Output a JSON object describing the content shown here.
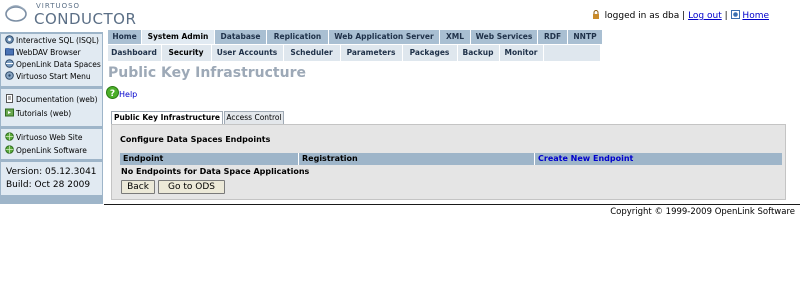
{
  "header": {
    "logo_small": "VIRTUOSO",
    "logo_big": "CONDUCTOR",
    "logged_in_text": "logged in as dba",
    "separator": "|",
    "logout_label": "Log out",
    "home_label": "Home"
  },
  "sidebar": {
    "group1": [
      {
        "label": "Interactive SQL (ISQL)",
        "icon": "isql-icon"
      },
      {
        "label": "WebDAV Browser",
        "icon": "folder-icon"
      },
      {
        "label": "OpenLink Data Spaces",
        "icon": "ods-icon"
      },
      {
        "label": "Virtuoso Start Menu",
        "icon": "virtuoso-icon"
      }
    ],
    "group2": [
      {
        "label": "Documentation (web)",
        "icon": "document-icon"
      },
      {
        "label": "Tutorials (web)",
        "icon": "tutorial-icon"
      }
    ],
    "group3": [
      {
        "label": "Virtuoso Web Site",
        "icon": "globe-icon"
      },
      {
        "label": "OpenLink Software",
        "icon": "globe-icon"
      }
    ],
    "version": "Version: 05.12.3041",
    "build": "Build: Oct 28 2009"
  },
  "top_tabs": [
    {
      "label": "Home"
    },
    {
      "label": "System Admin",
      "active": true
    },
    {
      "label": "Database"
    },
    {
      "label": "Replication"
    },
    {
      "label": "Web Application Server"
    },
    {
      "label": "XML"
    },
    {
      "label": "Web Services"
    },
    {
      "label": "RDF"
    },
    {
      "label": "NNTP"
    }
  ],
  "sub_tabs": [
    {
      "label": "Dashboard"
    },
    {
      "label": "Security",
      "active": true
    },
    {
      "label": "User Accounts"
    },
    {
      "label": "Scheduler"
    },
    {
      "label": "Parameters"
    },
    {
      "label": "Packages"
    },
    {
      "label": "Backup"
    },
    {
      "label": "Monitor"
    }
  ],
  "page_title": "Public Key Infrastructure",
  "help_label": "Help",
  "content_tabs": {
    "pki": "Public Key Infrastructure",
    "access_control": "Access Control"
  },
  "section_heading": "Configure Data Spaces Endpoints",
  "table": {
    "columns": [
      "Endpoint",
      "Registration"
    ],
    "create_link": "Create New Endpoint",
    "empty_message": "No Endpoints for Data Space Applications"
  },
  "buttons": {
    "back": "Back",
    "go_to_ods": "Go to ODS"
  },
  "footer": {
    "copyright": "Copyright © 1999-2009 OpenLink Software"
  },
  "colors": {
    "nav_blue": "#a9bfd2",
    "active_tab": "#e1eaf2",
    "sidebar_bg": "#9eb5c9",
    "link": "#0000cc",
    "title_gray": "#9da9b7"
  }
}
